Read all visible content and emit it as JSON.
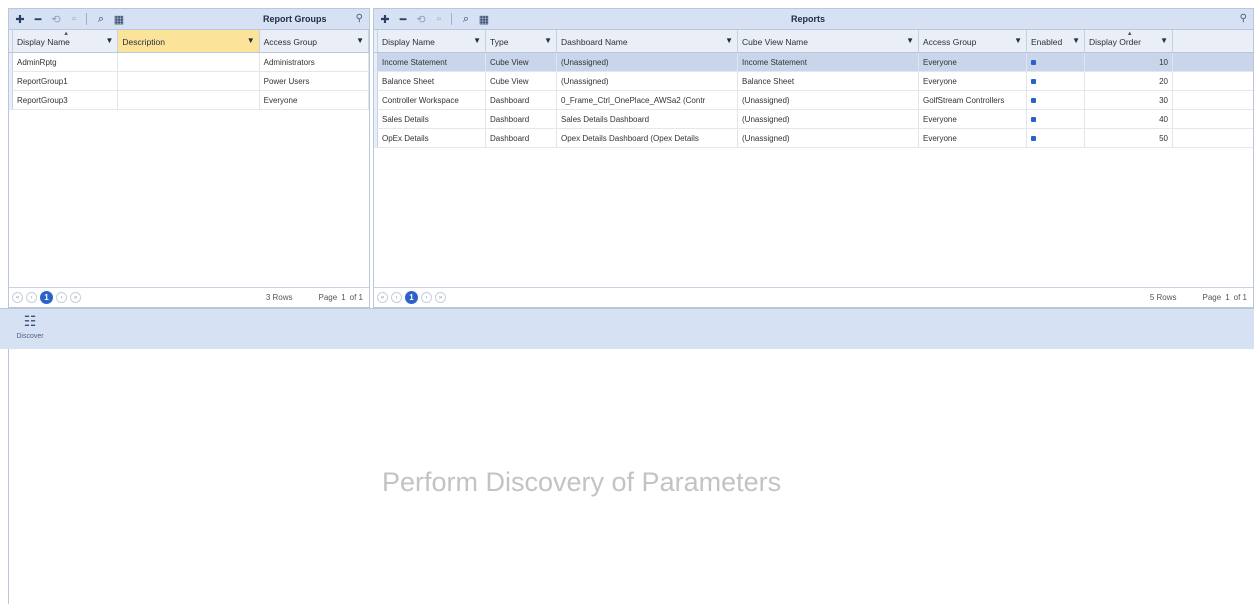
{
  "report_groups": {
    "title": "Report Groups",
    "columns": [
      {
        "label": "Display Name"
      },
      {
        "label": "Description"
      },
      {
        "label": "Access Group"
      }
    ],
    "rows": [
      {
        "display_name": "AdminRptg",
        "description": "",
        "access_group": "Administrators"
      },
      {
        "display_name": "ReportGroup1",
        "description": "",
        "access_group": "Power Users"
      },
      {
        "display_name": "ReportGroup3",
        "description": "",
        "access_group": "Everyone"
      }
    ],
    "pager": {
      "current_page": "1",
      "row_count": "3 Rows",
      "page_label": "Page",
      "page_num": "1",
      "page_of": "of 1"
    }
  },
  "reports": {
    "title": "Reports",
    "columns": [
      {
        "label": "Display Name"
      },
      {
        "label": "Type"
      },
      {
        "label": "Dashboard Name"
      },
      {
        "label": "Cube View Name"
      },
      {
        "label": "Access Group"
      },
      {
        "label": "Enabled"
      },
      {
        "label": "Display Order"
      }
    ],
    "rows": [
      {
        "display_name": "Income Statement",
        "type": "Cube View",
        "dashboard_name": "(Unassigned)",
        "cube_view_name": "Income Statement",
        "access_group": "Everyone",
        "enabled": true,
        "display_order": "10"
      },
      {
        "display_name": "Balance Sheet",
        "type": "Cube View",
        "dashboard_name": "(Unassigned)",
        "cube_view_name": "Balance Sheet",
        "access_group": "Everyone",
        "enabled": true,
        "display_order": "20"
      },
      {
        "display_name": "Controller Workspace",
        "type": "Dashboard",
        "dashboard_name": "0_Frame_Ctrl_OnePlace_AWSa2 (Contr",
        "cube_view_name": "(Unassigned)",
        "access_group": "GolfStream Controllers",
        "enabled": true,
        "display_order": "30"
      },
      {
        "display_name": "Sales Details",
        "type": "Dashboard",
        "dashboard_name": "Sales Details Dashboard",
        "cube_view_name": "(Unassigned)",
        "access_group": "Everyone",
        "enabled": true,
        "display_order": "40"
      },
      {
        "display_name": "OpEx Details",
        "type": "Dashboard",
        "dashboard_name": "Opex Details Dashboard (Opex Details",
        "cube_view_name": "(Unassigned)",
        "access_group": "Everyone",
        "enabled": true,
        "display_order": "50"
      }
    ],
    "selected_row": 0,
    "pager": {
      "current_page": "1",
      "row_count": "5 Rows",
      "page_label": "Page",
      "page_num": "1",
      "page_of": "of 1"
    }
  },
  "toolbar_icons": [
    "add-icon",
    "remove-icon",
    "refresh-icon",
    "save-icon",
    "search-icon",
    "grid-icon"
  ],
  "discover": {
    "label": "Discover",
    "icon": "sliders-icon"
  },
  "main_placeholder": "Perform Discovery of Parameters",
  "colors": {
    "accent": "#2b63c8",
    "toolbar_bg": "#d6e1f3",
    "header_highlight": "#fbe39a",
    "selected_row": "#c9d5ea"
  }
}
